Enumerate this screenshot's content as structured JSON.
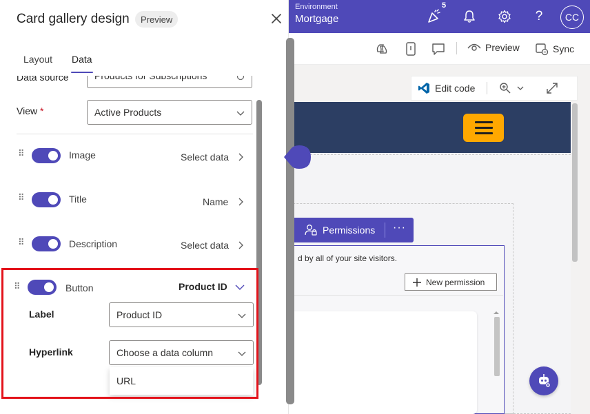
{
  "panel": {
    "title": "Card gallery design",
    "badge": "Preview",
    "tabs": [
      {
        "label": "Layout",
        "active": false
      },
      {
        "label": "Data",
        "active": true
      }
    ],
    "data_source": {
      "label": "Data source",
      "value": "Products for Subscriptions"
    },
    "view": {
      "label": "View",
      "required_mark": "*",
      "value": "Active Products"
    },
    "rows": [
      {
        "label": "Image",
        "enabled": true,
        "value": "Select data"
      },
      {
        "label": "Title",
        "enabled": true,
        "value": "Name"
      },
      {
        "label": "Description",
        "enabled": true,
        "value": "Select data"
      }
    ],
    "button_section": {
      "label": "Button",
      "enabled": true,
      "value": "Product ID",
      "label_field": {
        "label": "Label",
        "value": "Product ID"
      },
      "hyperlink_field": {
        "label": "Hyperlink",
        "placeholder": "Choose a data column"
      },
      "dropdown_options": [
        "URL"
      ]
    }
  },
  "topbar": {
    "environment_label": "Environment",
    "environment_name": "Mortgage",
    "notifications_badge": "5",
    "avatar_initials": "CC"
  },
  "commandbar": {
    "preview_label": "Preview",
    "sync_label": "Sync"
  },
  "editbar": {
    "edit_code_label": "Edit code"
  },
  "site": {
    "permissions_label": "Permissions",
    "more_label": "···",
    "info_text": "d by all of your site visitors.",
    "new_permission_label": "New permission"
  },
  "colors": {
    "brand": "#4f49b8",
    "header": "#2c3e63",
    "menu_button": "#ffa800",
    "highlight": "#e3131b"
  }
}
